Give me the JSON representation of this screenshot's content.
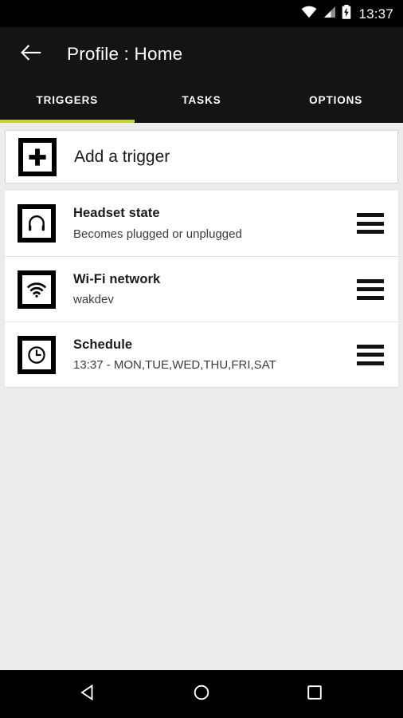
{
  "status_bar": {
    "time": "13:37",
    "icons": [
      "wifi-icon",
      "cellular-signal-icon",
      "battery-charging-icon"
    ]
  },
  "app_bar": {
    "back_icon": "back-arrow-icon",
    "title": "Profile : Home"
  },
  "tabs": {
    "active_index": 0,
    "indicator_color": "#c6d42b",
    "items": [
      {
        "label": "TRIGGERS"
      },
      {
        "label": "TASKS"
      },
      {
        "label": "OPTIONS"
      }
    ]
  },
  "add_trigger": {
    "label": "Add a trigger",
    "icon": "plus-square-icon"
  },
  "triggers": [
    {
      "icon": "headset-icon",
      "title": "Headset state",
      "subtitle": "Becomes plugged or unplugged",
      "handle": "drag-handle-icon"
    },
    {
      "icon": "wifi-icon",
      "title": "Wi-Fi network",
      "subtitle": "wakdev",
      "handle": "drag-handle-icon"
    },
    {
      "icon": "clock-icon",
      "title": "Schedule",
      "subtitle": "13:37 - MON,TUE,WED,THU,FRI,SAT",
      "handle": "drag-handle-icon"
    }
  ],
  "nav_bar": {
    "back": "nav-back-triangle-icon",
    "home": "nav-home-circle-icon",
    "recents": "nav-recents-square-icon"
  },
  "colors": {
    "accent": "#c6d42b",
    "app_bar": "#141414",
    "status_bar": "#000000",
    "page_background": "#ececec",
    "card": "#ffffff"
  }
}
